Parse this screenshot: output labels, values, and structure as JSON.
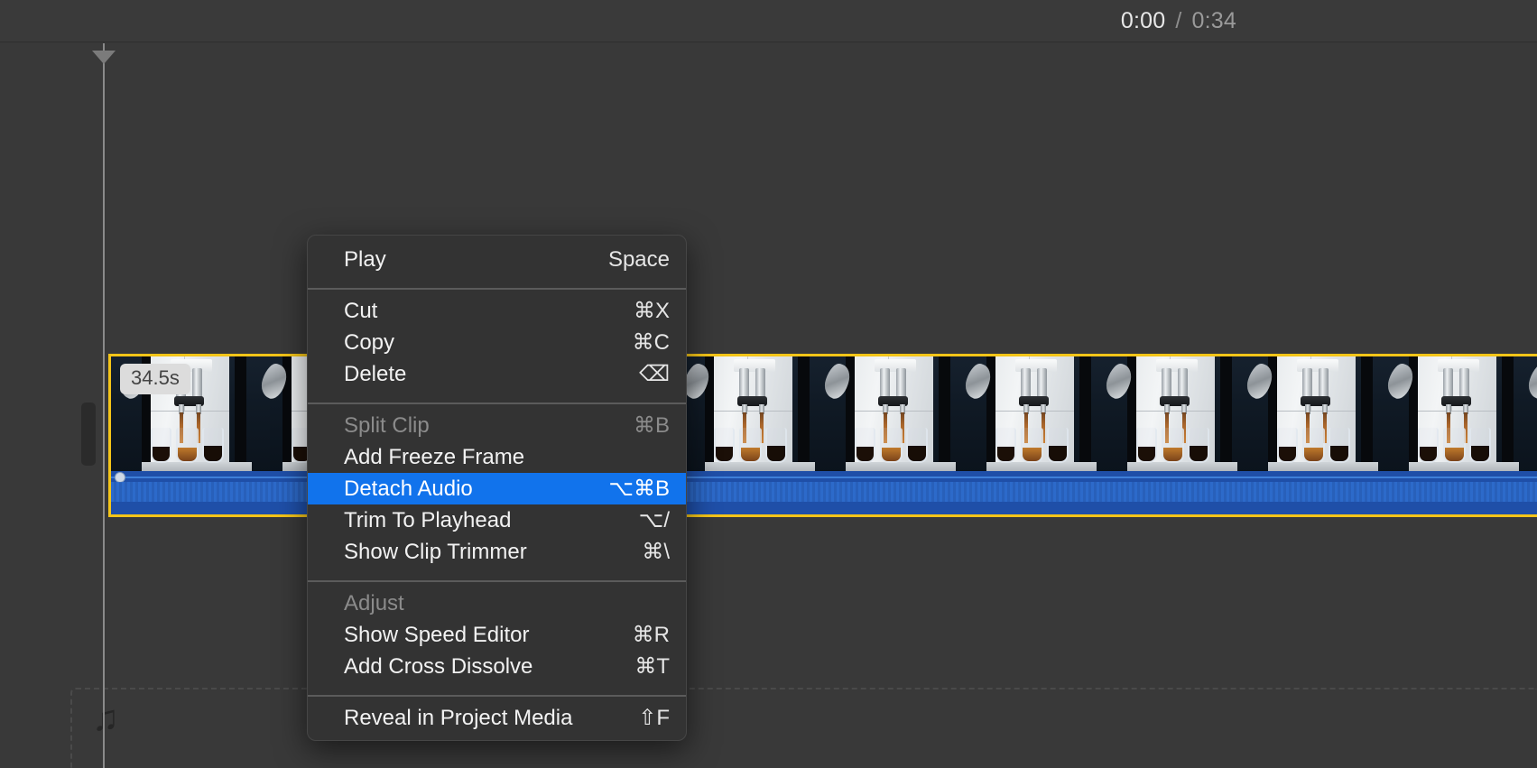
{
  "app": {
    "background_color": "#393939",
    "accent_color": "#1173ec",
    "selection_color": "#f5c518"
  },
  "topbar": {
    "current_time": "0:00",
    "time_separator": "/",
    "total_time": "0:34"
  },
  "timeline": {
    "playhead_label": "playhead",
    "clip": {
      "duration_badge": "34.5s",
      "selected": true,
      "frame_count": 11,
      "audio_track_color": "#1f4fa8",
      "border_color": "#f5c518"
    },
    "audio_dropzone": {
      "icon": "music-note-icon",
      "glyph": "♫"
    }
  },
  "context_menu": {
    "groups": [
      {
        "items": [
          {
            "label": "Play",
            "shortcut": "Space",
            "state": "enabled"
          }
        ]
      },
      {
        "items": [
          {
            "label": "Cut",
            "shortcut": "⌘X",
            "state": "enabled"
          },
          {
            "label": "Copy",
            "shortcut": "⌘C",
            "state": "enabled"
          },
          {
            "label": "Delete",
            "shortcut": "⌫",
            "state": "enabled"
          }
        ]
      },
      {
        "items": [
          {
            "label": "Split Clip",
            "shortcut": "⌘B",
            "state": "disabled"
          },
          {
            "label": "Add Freeze Frame",
            "shortcut": "",
            "state": "enabled"
          },
          {
            "label": "Detach Audio",
            "shortcut": "⌥⌘B",
            "state": "selected"
          },
          {
            "label": "Trim To Playhead",
            "shortcut": "⌥/",
            "state": "enabled"
          },
          {
            "label": "Show Clip Trimmer",
            "shortcut": "⌘\\",
            "state": "enabled"
          }
        ]
      },
      {
        "items": [
          {
            "label": "Adjust",
            "shortcut": "",
            "state": "disabled"
          },
          {
            "label": "Show Speed Editor",
            "shortcut": "⌘R",
            "state": "enabled"
          },
          {
            "label": "Add Cross Dissolve",
            "shortcut": "⌘T",
            "state": "enabled"
          }
        ]
      },
      {
        "items": [
          {
            "label": "Reveal in Project Media",
            "shortcut": "⇧F",
            "state": "enabled"
          }
        ]
      }
    ]
  }
}
